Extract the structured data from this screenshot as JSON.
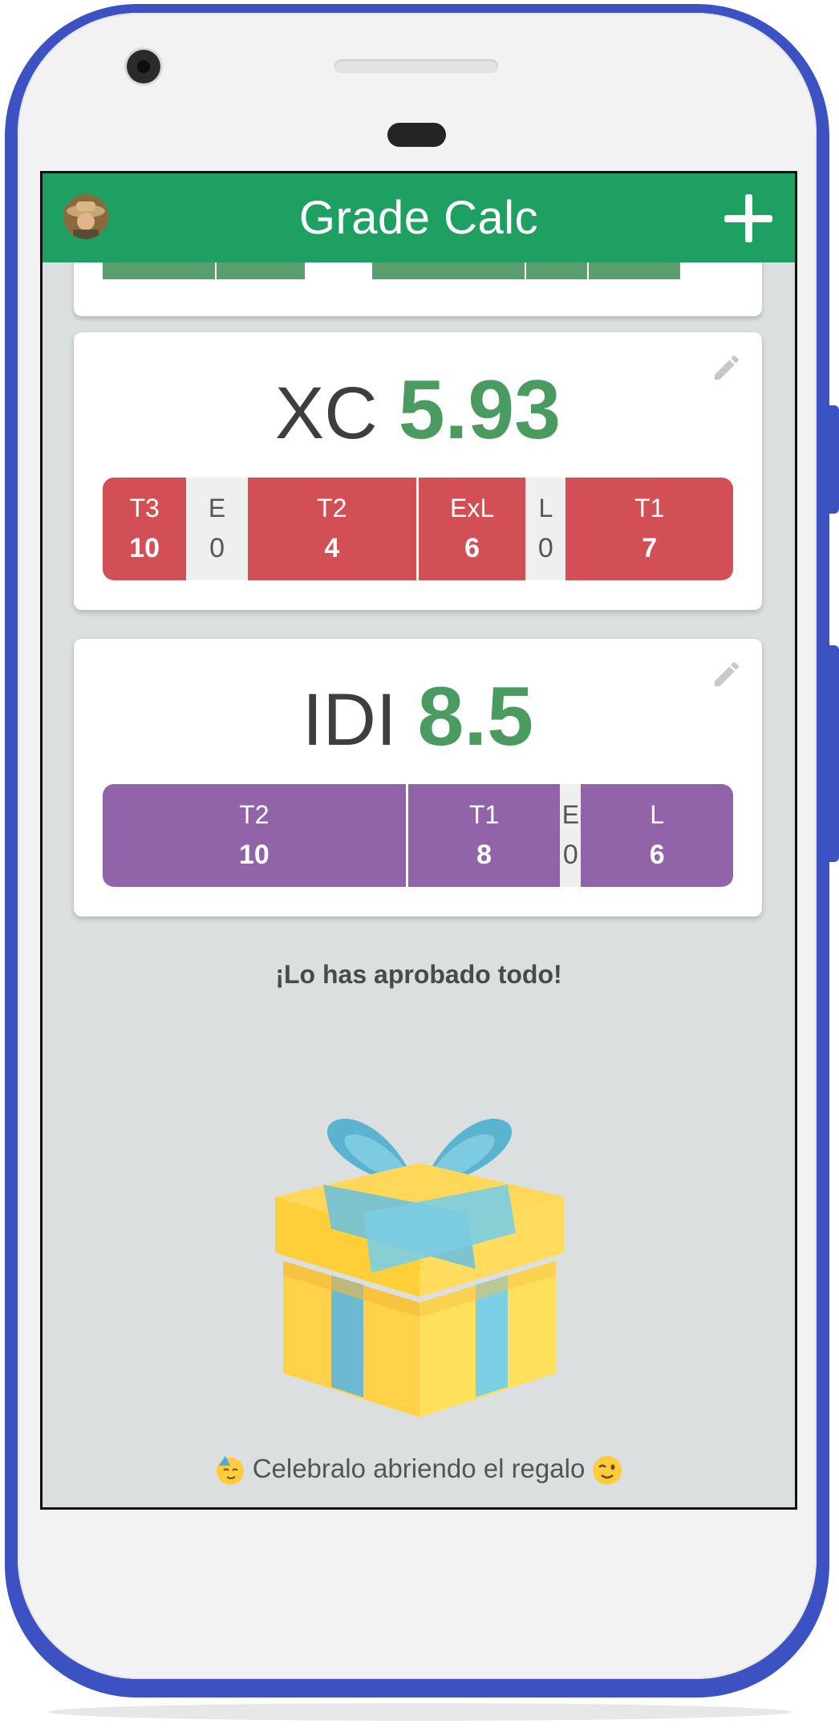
{
  "header": {
    "title": "Grade Calc"
  },
  "colors": {
    "header_bg": "#1fa063",
    "grade_text": "#4a9b5f",
    "xc_segment": "#d24f55",
    "idi_segment": "#9163a8",
    "empty_segment": "#efefef"
  },
  "icons": [
    "avatar",
    "add-icon",
    "edit-icon",
    "gift-icon",
    "partying-face-icon",
    "winking-face-icon"
  ],
  "subjects": [
    {
      "name": "XC",
      "grade": "5.93",
      "segments": [
        {
          "label": "T3",
          "value": "10",
          "filled": true,
          "weight": 75
        },
        {
          "label": "E",
          "value": "0",
          "filled": false,
          "weight": 55
        },
        {
          "label": "T2",
          "value": "4",
          "filled": true,
          "weight": 151
        },
        {
          "label": "ExL",
          "value": "6",
          "filled": true,
          "weight": 96
        },
        {
          "label": "L",
          "value": "0",
          "filled": false,
          "weight": 36
        },
        {
          "label": "T1",
          "value": "7",
          "filled": true,
          "weight": 150
        }
      ]
    },
    {
      "name": "IDI",
      "grade": "8.5",
      "segments": [
        {
          "label": "T2",
          "value": "10",
          "filled": true,
          "weight": 275
        },
        {
          "label": "T1",
          "value": "8",
          "filled": true,
          "weight": 138
        },
        {
          "label": "E",
          "value": "0",
          "filled": false,
          "weight": 19
        },
        {
          "label": "L",
          "value": "6",
          "filled": true,
          "weight": 138
        }
      ]
    }
  ],
  "messages": {
    "passed": "¡Lo has aprobado todo!",
    "celebrate": "Celebralo abriendo el regalo"
  }
}
